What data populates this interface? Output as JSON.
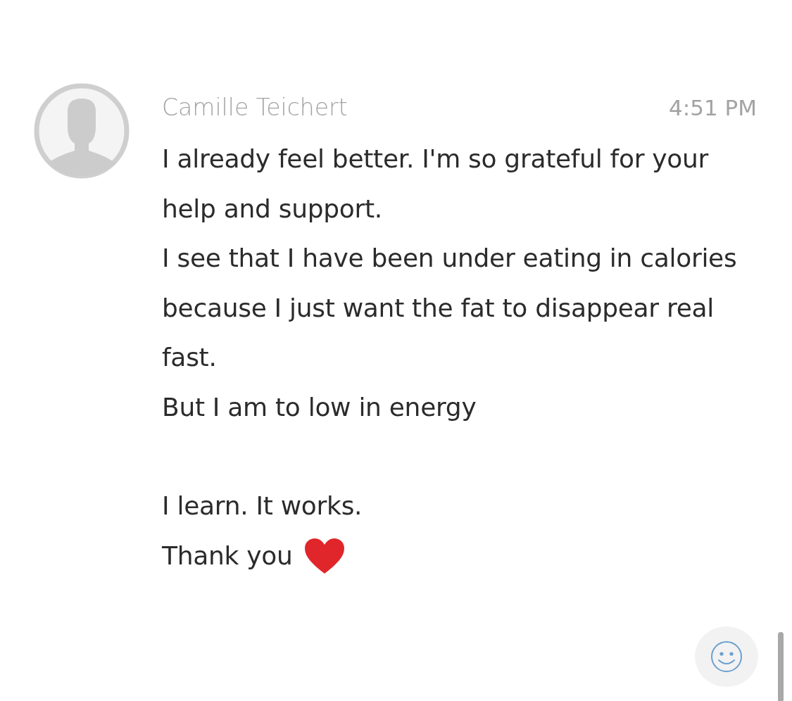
{
  "message": {
    "sender": "Camille Teichert",
    "time": "4:51 PM",
    "paragraphs": [
      {
        "lines": [
          "I already feel better. I'm so grateful for your help and support.",
          "I see that I have been under eating in calories because I just want the fat to disappear real fast.",
          "But I am to low in energy"
        ]
      },
      {
        "lines": [
          "I learn. It works.",
          "Thank you"
        ]
      }
    ]
  }
}
